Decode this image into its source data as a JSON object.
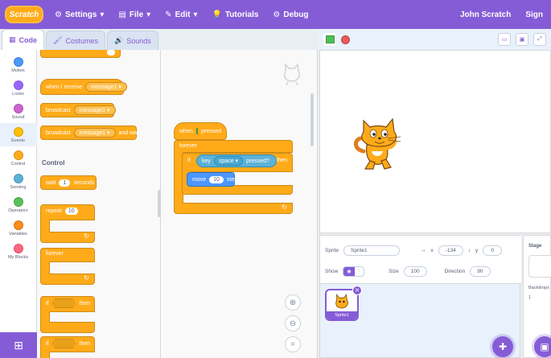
{
  "menu": {
    "logo": "Scratch",
    "settings": "Settings",
    "file": "File",
    "edit": "Edit",
    "tutorials": "Tutorials",
    "debug": "Debug",
    "username": "John Scratch",
    "sign": "Sign"
  },
  "tabs": {
    "code": "Code",
    "costumes": "Costumes",
    "sounds": "Sounds"
  },
  "categories": [
    {
      "label": "Motion",
      "color": "#4c97ff"
    },
    {
      "label": "Looks",
      "color": "#9966ff"
    },
    {
      "label": "Sound",
      "color": "#cf63cf"
    },
    {
      "label": "Events",
      "color": "#ffbf00"
    },
    {
      "label": "Control",
      "color": "#ffab19"
    },
    {
      "label": "Sensing",
      "color": "#5cb1d6"
    },
    {
      "label": "Operators",
      "color": "#59c059"
    },
    {
      "label": "Variables",
      "color": "#ff8c1a"
    },
    {
      "label": "My Blocks",
      "color": "#ff6680"
    }
  ],
  "palette": {
    "broadcast_pill": "",
    "when_receive": "when I receive",
    "message": "message1",
    "broadcast": "broadcast",
    "broadcast_wait": "broadcast",
    "and_wait": "and wait",
    "control_heading": "Control",
    "wait": "wait",
    "wait_val": "1",
    "seconds": "seconds",
    "repeat": "repeat",
    "repeat_val": "10",
    "forever": "forever",
    "if_label": "if",
    "then": "then"
  },
  "script": {
    "when_key": "when",
    "key": "",
    "pressed": "pressed",
    "forever": "forever",
    "if": "if",
    "touching": "key",
    "space": "space",
    "pressed2": "pressed?",
    "then": "then",
    "move": "move",
    "steps_val": "10",
    "steps": "steps"
  },
  "sprite_info": {
    "sprite_label": "Sprite",
    "sprite_name": "Sprite1",
    "x_label": "x",
    "x_val": "-134",
    "y_label": "y",
    "y_val": "0",
    "show_label": "Show",
    "size_label": "Size",
    "size_val": "100",
    "direction_label": "Direction",
    "direction_val": "90",
    "thumb_name": "Sprite1"
  },
  "stage_pane": {
    "title": "Stage",
    "backdrops": "Backdrops",
    "count": "1"
  },
  "colors": {
    "accent": "#855cd6",
    "control": "#ffab19",
    "sensing": "#5cb1d6",
    "go": "#4cbf56",
    "stop": "#ec5959"
  }
}
